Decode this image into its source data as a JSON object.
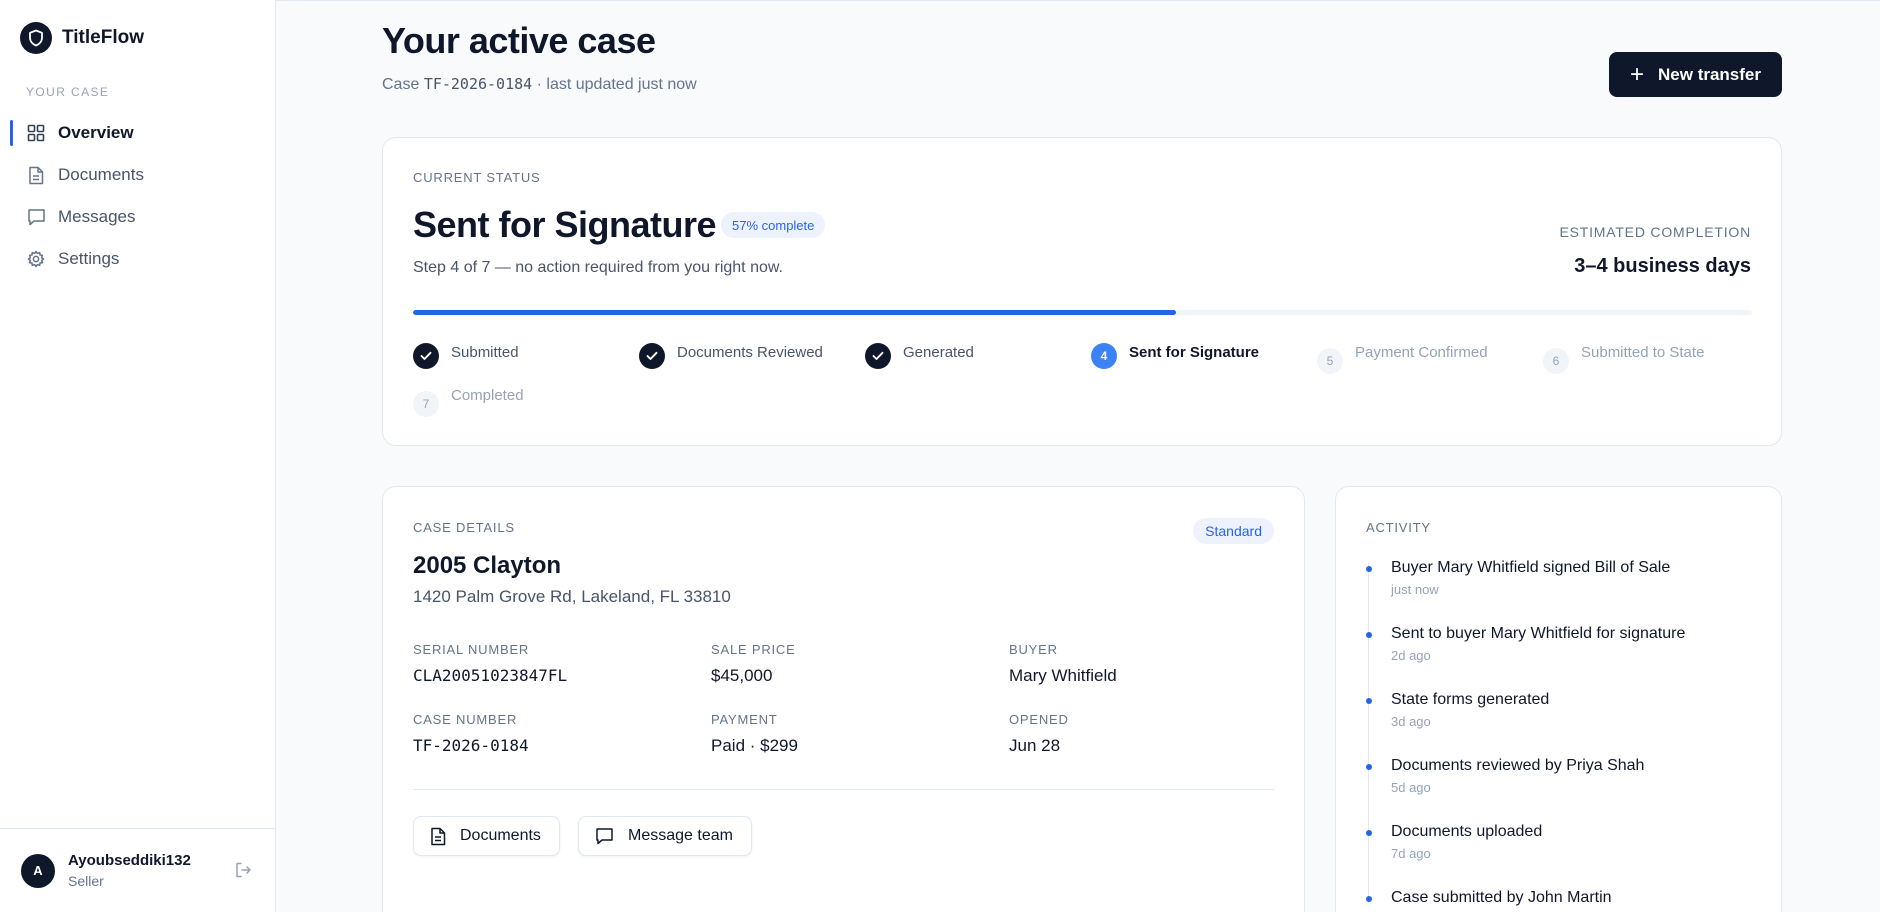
{
  "app": {
    "name": "TitleFlow"
  },
  "sidebar": {
    "section_label": "YOUR CASE",
    "items": [
      {
        "label": "Overview",
        "icon": "grid-icon",
        "active": true
      },
      {
        "label": "Documents",
        "icon": "document-icon",
        "active": false
      },
      {
        "label": "Messages",
        "icon": "message-icon",
        "active": false
      },
      {
        "label": "Settings",
        "icon": "gear-icon",
        "active": false
      }
    ],
    "user": {
      "initial": "A",
      "name": "Ayoubseddiki132",
      "role": "Seller"
    }
  },
  "header": {
    "title": "Your active case",
    "case_prefix": "Case",
    "case_id": "TF-2026-0184",
    "updated": "· last updated just now",
    "new_transfer_label": "New transfer"
  },
  "status": {
    "eyebrow": "CURRENT STATUS",
    "title": "Sent for Signature",
    "percent_badge": "57% complete",
    "progress": 0.57,
    "step_text": "Step 4 of 7 — no action required from you right now.",
    "eta_label": "ESTIMATED COMPLETION",
    "eta_value": "3–4 business days",
    "steps": [
      {
        "number": "1",
        "label": "Submitted",
        "state": "done"
      },
      {
        "number": "2",
        "label": "Documents Reviewed",
        "state": "done"
      },
      {
        "number": "3",
        "label": "Generated",
        "state": "done"
      },
      {
        "number": "4",
        "label": "Sent for Signature",
        "state": "current"
      },
      {
        "number": "5",
        "label": "Payment Confirmed",
        "state": "pending"
      },
      {
        "number": "6",
        "label": "Submitted to State",
        "state": "pending"
      },
      {
        "number": "7",
        "label": "Completed",
        "state": "pending"
      }
    ]
  },
  "details": {
    "eyebrow": "CASE DETAILS",
    "badge": "Standard",
    "vehicle": "2005 Clayton",
    "address": "1420 Palm Grove Rd, Lakeland, FL 33810",
    "fields": [
      {
        "label": "SERIAL NUMBER",
        "value": "CLA20051023847FL"
      },
      {
        "label": "SALE PRICE",
        "value": "$45,000"
      },
      {
        "label": "BUYER",
        "value": "Mary Whitfield"
      },
      {
        "label": "CASE NUMBER",
        "value": "TF-2026-0184"
      },
      {
        "label": "PAYMENT",
        "value": "Paid · $299"
      },
      {
        "label": "OPENED",
        "value": "Jun 28"
      }
    ],
    "documents_button": "Documents",
    "message_button": "Message team"
  },
  "activity": {
    "eyebrow": "ACTIVITY",
    "items": [
      {
        "text": "Buyer Mary Whitfield signed Bill of Sale",
        "time": "just now"
      },
      {
        "text": "Sent to buyer Mary Whitfield for signature",
        "time": "2d ago"
      },
      {
        "text": "State forms generated",
        "time": "3d ago"
      },
      {
        "text": "Documents reviewed by Priya Shah",
        "time": "5d ago"
      },
      {
        "text": "Documents uploaded",
        "time": "7d ago"
      },
      {
        "text": "Case submitted by John Martin",
        "time": ""
      }
    ]
  },
  "colors": {
    "accent": "#2563eb",
    "ink": "#0f172a",
    "muted": "#64748b",
    "border": "#e2e8f0"
  }
}
